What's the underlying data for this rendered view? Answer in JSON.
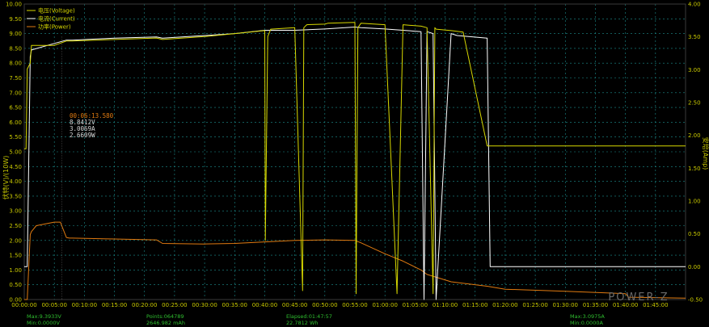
{
  "chart_data": {
    "type": "line",
    "title": "",
    "ylabel_left": "伏特(V)/(10W)",
    "ylabel_right": "安培(Amp)",
    "y_left_range": [
      0,
      10
    ],
    "y_right_range": [
      -0.5,
      4.0
    ],
    "x_range_min": [
      0,
      110
    ],
    "grid": true,
    "legend_position": "top-left",
    "watermark": "POWER-Z",
    "y_left_ticks": [
      "0.00",
      "0.50",
      "1.00",
      "1.50",
      "2.00",
      "2.50",
      "3.00",
      "3.50",
      "4.00",
      "4.50",
      "5.00",
      "5.50",
      "6.00",
      "6.50",
      "7.00",
      "7.50",
      "8.00",
      "8.50",
      "9.00",
      "9.50",
      "10.00"
    ],
    "y_right_ticks": [
      "-0.50",
      "0.00",
      "0.50",
      "1.00",
      "1.50",
      "2.00",
      "2.50",
      "3.00",
      "3.50",
      "4.00"
    ],
    "x_ticks": [
      "00:00:00",
      "00:05:00",
      "00:10:00",
      "00:15:00",
      "00:20:00",
      "00:25:00",
      "00:30:00",
      "00:35:00",
      "00:40:00",
      "00:45:00",
      "00:50:00",
      "00:55:00",
      "01:00:00",
      "01:05:00",
      "01:10:00",
      "01:15:00",
      "01:20:00",
      "01:25:00",
      "01:30:00",
      "01:35:00",
      "01:40:00",
      "01:45:00"
    ],
    "series": [
      {
        "name": "电压(Voltage)",
        "color": "#d8d800",
        "axis": "left",
        "x": [
          0,
          0.3,
          0.5,
          1,
          1.2,
          5,
          7,
          7.5,
          8,
          15,
          22,
          23,
          30,
          35,
          40,
          40.1,
          40.5,
          41,
          45,
          46.3,
          46.5,
          47,
          50,
          50.5,
          55,
          55.2,
          55.5,
          56,
          60,
          62,
          63,
          66,
          67,
          68,
          68.3,
          68.5,
          71,
          73,
          77,
          77.3,
          78,
          80,
          90,
          100,
          110
        ],
        "y": [
          5.1,
          5.1,
          7.8,
          8.0,
          8.6,
          8.6,
          8.75,
          8.75,
          8.75,
          8.8,
          8.85,
          8.8,
          8.9,
          9.0,
          9.1,
          2.0,
          8.9,
          9.15,
          9.2,
          0.3,
          9.2,
          9.3,
          9.32,
          9.35,
          9.38,
          0.2,
          9.2,
          9.35,
          9.3,
          0.2,
          9.3,
          9.25,
          9.2,
          0.2,
          9.2,
          9.15,
          9.1,
          9.05,
          5.2,
          5.2,
          5.2,
          5.2,
          5.2,
          5.2,
          5.2
        ]
      },
      {
        "name": "电流(Current)",
        "color": "#d8d800",
        "axis": "right",
        "x": [
          0,
          0.5,
          1,
          1.2,
          5,
          7,
          7.5,
          8,
          15,
          22,
          23,
          30,
          35,
          40,
          45,
          50,
          55,
          56,
          60,
          63,
          66,
          66.5,
          67,
          68,
          68.5,
          71,
          72,
          77,
          77.5,
          110
        ],
        "y": [
          0,
          0,
          3.2,
          3.3,
          3.4,
          3.45,
          3.45,
          3.45,
          3.48,
          3.5,
          3.48,
          3.52,
          3.55,
          3.6,
          3.6,
          3.62,
          3.65,
          3.64,
          3.62,
          3.6,
          3.58,
          -0.5,
          3.58,
          3.55,
          -0.5,
          3.55,
          3.52,
          3.48,
          0.0,
          0.0
        ]
      },
      {
        "name": "功率(Power)",
        "color": "#e07a10",
        "axis": "left",
        "x": [
          0,
          0.5,
          1,
          1.2,
          2,
          5,
          6,
          7,
          7.5,
          8,
          15,
          22,
          23,
          30,
          35,
          40,
          45,
          50,
          55,
          56,
          60,
          63,
          66,
          67,
          71,
          77,
          80,
          90,
          100,
          100.5,
          110
        ],
        "y": [
          0,
          0,
          2.2,
          2.3,
          2.5,
          2.62,
          2.62,
          2.1,
          2.08,
          2.08,
          2.05,
          2.02,
          1.9,
          1.88,
          1.9,
          1.95,
          2.0,
          2.02,
          2.0,
          1.92,
          1.55,
          1.3,
          1.0,
          0.85,
          0.6,
          0.45,
          0.35,
          0.28,
          0.2,
          0.08,
          0.05
        ]
      }
    ]
  },
  "cursor": {
    "time": "00:06:13.580",
    "voltage": "8.8412V",
    "current": "3.0069A",
    "power": "2.6609W"
  },
  "footer": {
    "max_voltage": "Max:9.3933V",
    "min_voltage": "Min:0.0000V",
    "points": "Points:064789",
    "capacity": "2646.982 mAh",
    "elapsed": "Elapsed:01:47:57",
    "energy": "22.7812 Wh",
    "max_current": "Max:3.0975A",
    "min_current": "Min:0.0000A"
  },
  "colors": {
    "background": "#000000",
    "voltage": "#d8d800",
    "current": "#ffffff",
    "power": "#e07a10",
    "grid": "#1c8f8f",
    "axis": "#c9c900",
    "footer": "#2fbf2f",
    "cursor_time": "#e07a10",
    "cursor_values": "#d8d8d8"
  }
}
